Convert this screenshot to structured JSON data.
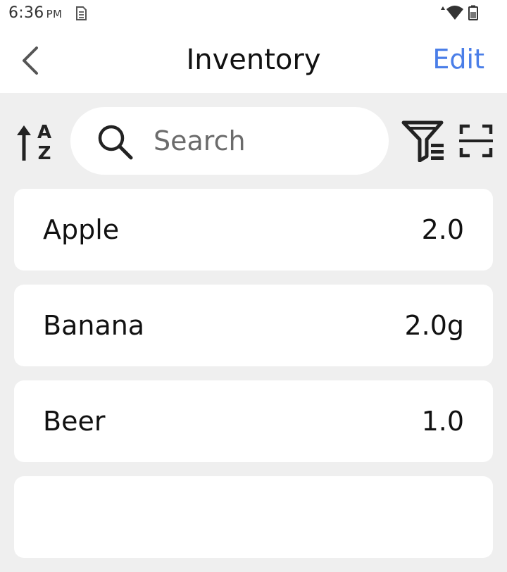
{
  "status_bar": {
    "time": "6:36",
    "ampm": "PM",
    "icons": [
      "sim-icon",
      "data-arrows-icon",
      "wifi-icon",
      "battery-icon"
    ]
  },
  "app_bar": {
    "title": "Inventory",
    "back_icon": "chevron-left-icon",
    "edit_label": "Edit"
  },
  "toolbar": {
    "sort_icon": "sort-az-icon",
    "search_placeholder": "Search",
    "search_value": "",
    "filter_icon": "filter-list-icon",
    "scan_icon": "barcode-scan-icon"
  },
  "items": [
    {
      "name": "Apple",
      "quantity": "2.0"
    },
    {
      "name": "Banana",
      "quantity": "2.0g"
    },
    {
      "name": "Beer",
      "quantity": "1.0"
    },
    {
      "name": "",
      "quantity": ""
    }
  ],
  "colors": {
    "accent": "#4a7ee8",
    "background": "#efefef",
    "card": "#ffffff"
  }
}
